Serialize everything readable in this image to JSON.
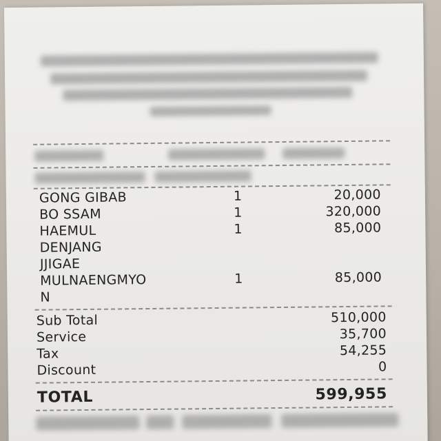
{
  "items": [
    {
      "name": "GONG GIBAB",
      "qty": "1",
      "price": "20,000"
    },
    {
      "name": "BO SSAM",
      "qty": "1",
      "price": "320,000"
    },
    {
      "name": "HAEMUL",
      "qty": "1",
      "price": "85,000"
    },
    {
      "name": "DENJANG",
      "qty": "",
      "price": ""
    },
    {
      "name": "JJIGAE",
      "qty": "",
      "price": ""
    },
    {
      "name": "MULNAENGMYO",
      "qty": "1",
      "price": "85,000"
    },
    {
      "name": "N",
      "qty": "",
      "price": ""
    }
  ],
  "summary": {
    "subtotal_label": "Sub Total",
    "subtotal_value": "510,000",
    "service_label": "Service",
    "service_value": "35,700",
    "tax_label": "Tax",
    "tax_value": "54,255",
    "discount_label": "Discount",
    "discount_value": "0"
  },
  "total": {
    "label": "TOTAL",
    "value": "599,955"
  }
}
